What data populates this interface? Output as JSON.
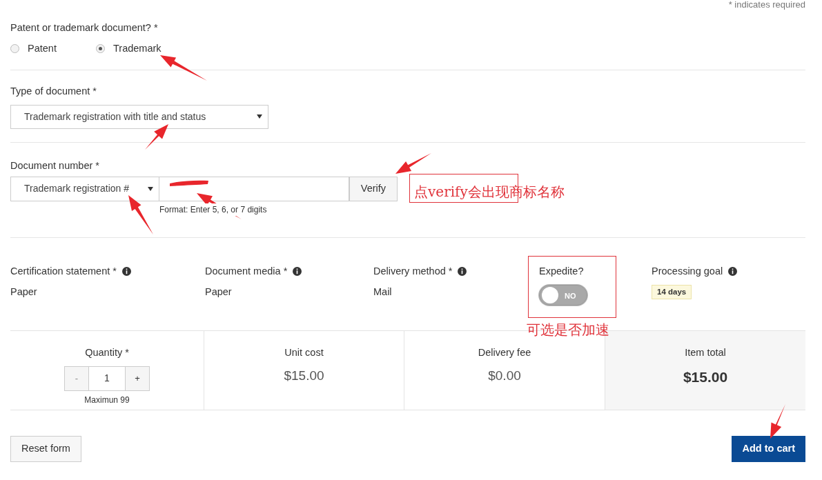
{
  "required_note": "* indicates required",
  "doc_kind": {
    "label": "Patent or trademark document? *",
    "options": [
      {
        "label": "Patent",
        "selected": false
      },
      {
        "label": "Trademark",
        "selected": true
      }
    ]
  },
  "doc_type": {
    "label": "Type of document *",
    "value": "Trademark registration with title and status"
  },
  "doc_number": {
    "label": "Document number *",
    "number_type": "Trademark registration #",
    "verify": "Verify",
    "help": "Format: Enter 5, 6, or 7 digits"
  },
  "details": [
    {
      "kind": "text",
      "label": "Certification statement *",
      "info": true,
      "value": "Paper"
    },
    {
      "kind": "text",
      "label": "Document media *",
      "info": true,
      "value": "Paper"
    },
    {
      "kind": "text",
      "label": "Delivery method *",
      "info": true,
      "value": "Mail"
    },
    {
      "kind": "toggle",
      "label": "Expedite?",
      "info": false,
      "on": false,
      "value": "NO"
    },
    {
      "kind": "badge",
      "label": "Processing goal",
      "info": true,
      "value": "14 days"
    }
  ],
  "quantity": {
    "label": "Quantity *",
    "minus": "-",
    "value": "1",
    "plus": "+",
    "note": "Maximun 99"
  },
  "costs": [
    {
      "label": "Unit cost",
      "value": "$15.00",
      "total": false
    },
    {
      "label": "Delivery fee",
      "value": "$0.00",
      "total": false
    },
    {
      "label": "Item total",
      "value": "$15.00",
      "total": true
    }
  ],
  "buttons": {
    "reset": "Reset form",
    "submit": "Add to cart"
  },
  "annotations": [
    {
      "kind": "note",
      "text": "点verify会出现商标名称"
    },
    {
      "kind": "note",
      "text": "可选是否加速"
    }
  ]
}
